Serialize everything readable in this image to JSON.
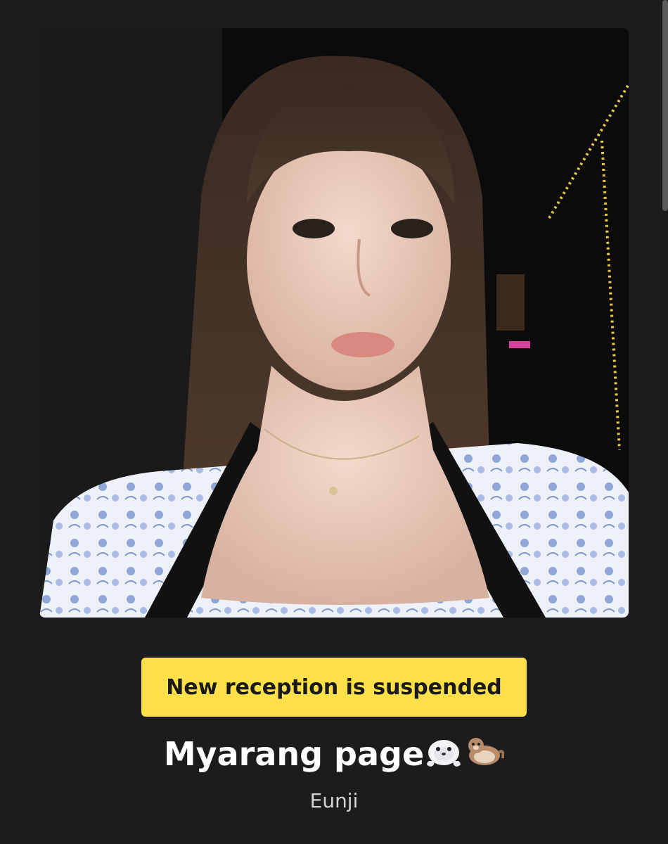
{
  "status": {
    "label": "New reception is suspended",
    "color": "#fde047"
  },
  "profile": {
    "title": "Myarang page",
    "title_icons": [
      "seal-emoji",
      "otter-emoji"
    ],
    "subtitle": "Eunji"
  },
  "colors": {
    "background": "#1c1c1e",
    "text": "#ffffff"
  }
}
